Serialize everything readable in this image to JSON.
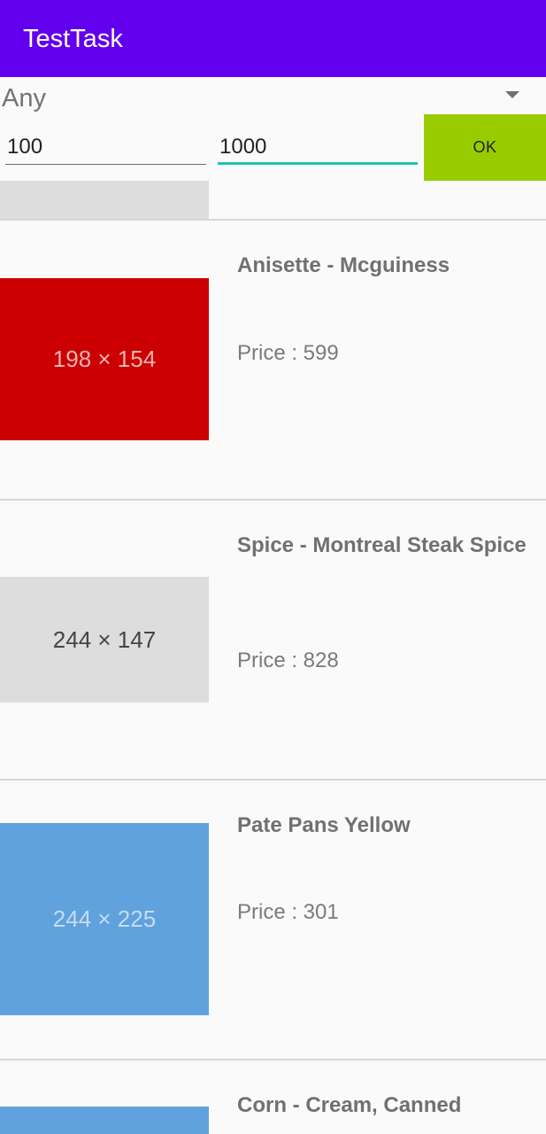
{
  "app": {
    "title": "TestTask"
  },
  "filter": {
    "category": "Any",
    "min_price": "100",
    "max_price": "1000",
    "ok_label": "OK",
    "colors": {
      "ok_bg": "#99cc00",
      "active_underline": "#22c2b8"
    }
  },
  "theme": {
    "appbar": "#6200ee",
    "background": "#fafafa"
  },
  "products": [
    {
      "name": "Anisette - Mcguiness",
      "price": "Price : 599",
      "image_label": "198 × 154",
      "image_bg": "#cc0000",
      "image_fg": "#e9b3b3"
    },
    {
      "name": "Spice - Montreal Steak Spice",
      "price": "Price : 828",
      "image_label": "244 × 147",
      "image_bg": "#dddddd",
      "image_fg": "#444444"
    },
    {
      "name": "Pate Pans Yellow",
      "price": "Price : 301",
      "image_label": "244 × 225",
      "image_bg": "#5fa2dd",
      "image_fg": "#c6dcf1"
    },
    {
      "name": "Corn - Cream, Canned",
      "price": "",
      "image_label": "",
      "image_bg": "#5fa2dd",
      "image_fg": "#c6dcf1"
    }
  ]
}
